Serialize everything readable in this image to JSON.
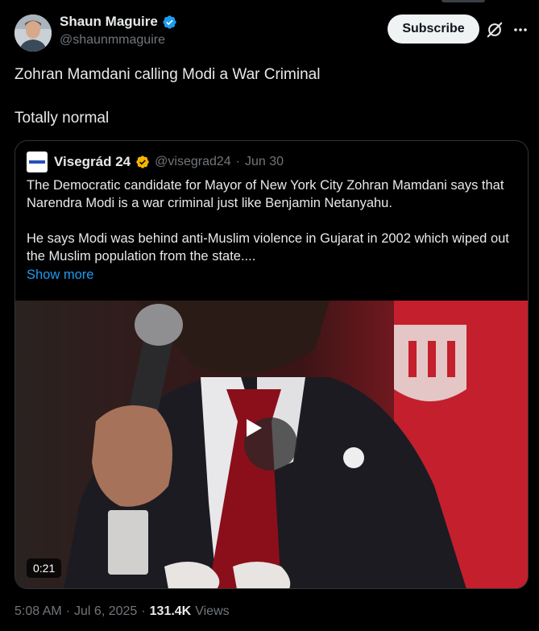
{
  "author": {
    "display_name": "Shaun Maguire",
    "handle": "@shaunmmaguire",
    "verified_icon": "verified-badge-icon",
    "verified_color": "#1d9bf0"
  },
  "actions": {
    "subscribe_label": "Subscribe",
    "grok_icon": "grok-icon",
    "more_icon": "more-icon"
  },
  "tweet": {
    "lines": [
      "Zohran Mamdani calling Modi a War Criminal",
      "Totally normal"
    ]
  },
  "quote": {
    "display_name": "Visegrád 24",
    "handle": "@visegrad24",
    "separator": "·",
    "date": "Jun 30",
    "verified_color": "#f4b400",
    "paragraphs": [
      "The Democratic candidate for Mayor of New York City Zohran Mamdani says that Narendra Modi is a war criminal just like Benjamin Netanyahu.",
      "He says Modi was behind anti-Muslim violence in Gujarat in 2002 which wiped out the Muslim population from the state...."
    ],
    "show_more": "Show more",
    "video": {
      "duration": "0:21",
      "play_icon": "play-icon"
    }
  },
  "meta": {
    "time": "5:08 AM",
    "sep1": "·",
    "date": "Jul 6, 2025",
    "sep2": "·",
    "views_count": "131.4K",
    "views_label": "Views"
  },
  "colors": {
    "background": "#000000",
    "text": "#e7e9ea",
    "muted": "#71767b",
    "link": "#1d9bf0",
    "border": "#2f3336"
  }
}
